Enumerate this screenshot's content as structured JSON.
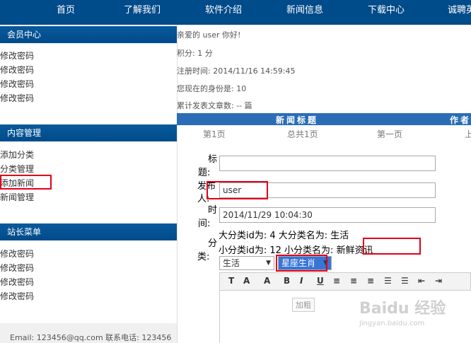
{
  "nav": {
    "items": [
      "首页",
      "了解我们",
      "软件介绍",
      "新闻信息",
      "下载中心",
      "诚聘英"
    ]
  },
  "sidebar": {
    "member_title": "会员中心",
    "member_items": [
      "修改密码",
      "修改密码",
      "修改密码",
      "修改密码"
    ],
    "content_title": "内容管理",
    "content_items": [
      "添加分类",
      "分类管理",
      "添加新闻",
      "新闻管理"
    ],
    "admin_title": "站长菜单",
    "admin_items": [
      "修改密码",
      "修改密码",
      "修改密码",
      "修改密码"
    ],
    "footer": "Email: 123456@qq.com 联系电话: 123456"
  },
  "welcome": {
    "greeting": "亲爱的 user 你好!",
    "points": "积分: 1 分",
    "reg_time": "注册时间: 2014/11/16 14:59:45",
    "identity": "您现在的身份是: 10",
    "articles": "累计发表文章数: -- 篇"
  },
  "table": {
    "col_title": "新闻标题",
    "col_author": "作者"
  },
  "pager": {
    "current": "第1页",
    "total": "总共1页",
    "first": "第一页",
    "prev": "上"
  },
  "form": {
    "title_label_1": "标",
    "title_label_2": "题:",
    "author_label_1": "发布",
    "author_label_2": "人:",
    "author_value": "user",
    "time_label_1": "时",
    "time_label_2": "间:",
    "time_value": "2014/11/29 10:04:30",
    "cat_label_1": "分",
    "cat_label_2": "类:",
    "big_cat": "大分类id为: 4 大分类名为: 生活",
    "small_cat_prefix": "小分类id为: 12 小分类名为:",
    "small_cat_name": "新鲜资讯",
    "select_big": "生活",
    "select_small": "星座生肖"
  },
  "editor": {
    "tooltip": "加粗"
  },
  "watermark": {
    "main": "Baidu 经验",
    "sub": "jingyan.baidu.com"
  },
  "colors": {
    "nav_bg": "#004b8a",
    "table_head_bg": "#2a6db6",
    "highlight": "#e0001a"
  }
}
